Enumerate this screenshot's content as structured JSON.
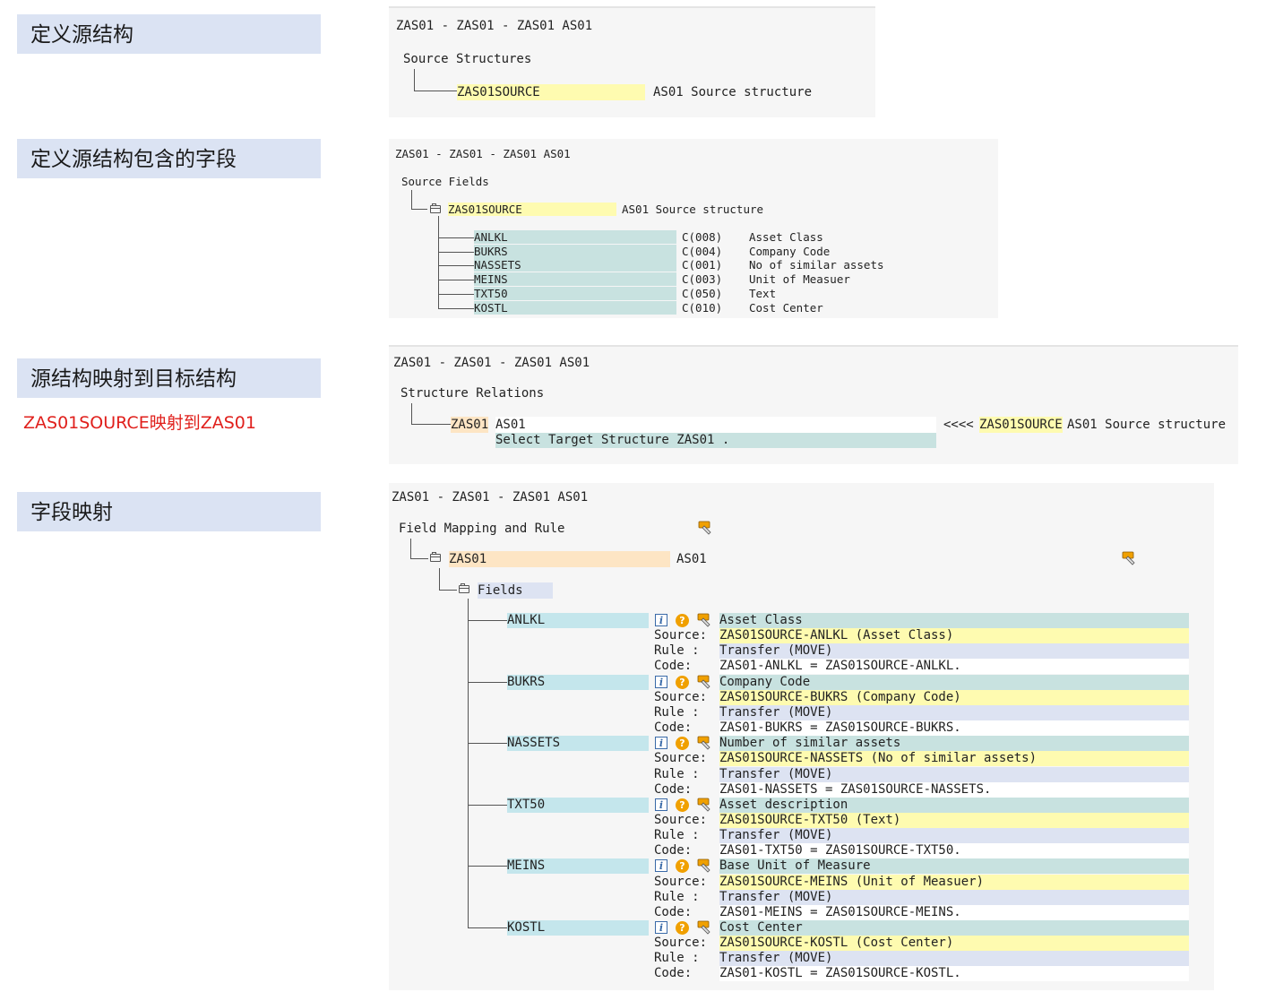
{
  "labels": {
    "define_source": "定义源结构",
    "define_fields": "定义源结构包含的字段",
    "map_structure": "源结构映射到目标结构",
    "map_note": "ZAS01SOURCE映射到ZAS01",
    "field_mapping": "字段映射"
  },
  "panel1": {
    "header": "ZAS01 - ZAS01 - ZAS01 AS01",
    "section": "Source Structures",
    "structure_name": "ZAS01SOURCE",
    "structure_desc": "AS01 Source structure"
  },
  "panel2": {
    "header": "ZAS01 - ZAS01 - ZAS01 AS01",
    "section": "Source Fields",
    "structure_name": "ZAS01SOURCE",
    "structure_desc": "AS01 Source structure",
    "fields": [
      {
        "name": "ANLKL",
        "type": "C(008)",
        "desc": "Asset Class"
      },
      {
        "name": "BUKRS",
        "type": "C(004)",
        "desc": "Company Code"
      },
      {
        "name": "NASSETS",
        "type": "C(001)",
        "desc": "No of similar assets"
      },
      {
        "name": "MEINS",
        "type": "C(003)",
        "desc": "Unit of Measuer"
      },
      {
        "name": "TXT50",
        "type": "C(050)",
        "desc": "Text"
      },
      {
        "name": "KOSTL",
        "type": "C(010)",
        "desc": "Cost Center"
      }
    ]
  },
  "panel3": {
    "header": "ZAS01 - ZAS01 - ZAS01 AS01",
    "section": "Structure Relations",
    "target_name": "ZAS01",
    "target_desc": "AS01",
    "select_text": "Select Target Structure ZAS01 .",
    "arrows": "<<<<",
    "source_name": "ZAS01SOURCE",
    "source_desc": "AS01 Source structure"
  },
  "panel4": {
    "header": "ZAS01 - ZAS01 - ZAS01 AS01",
    "section": "Field Mapping and Rule",
    "structure_name": "ZAS01",
    "structure_desc": "AS01",
    "fields_label": "Fields",
    "source_label": "Source:",
    "rule_label": "Rule :",
    "code_label": "Code:",
    "info_glyph": "i",
    "help_glyph": "?",
    "mappings": [
      {
        "name": "ANLKL",
        "desc": "Asset Class",
        "source": "ZAS01SOURCE-ANLKL (Asset Class)",
        "rule": "Transfer (MOVE)",
        "code": "ZAS01-ANLKL = ZAS01SOURCE-ANLKL."
      },
      {
        "name": "BUKRS",
        "desc": "Company Code",
        "source": "ZAS01SOURCE-BUKRS (Company Code)",
        "rule": "Transfer (MOVE)",
        "code": "ZAS01-BUKRS = ZAS01SOURCE-BUKRS."
      },
      {
        "name": "NASSETS",
        "desc": "Number of similar assets",
        "source": "ZAS01SOURCE-NASSETS (No of similar assets)",
        "rule": "Transfer (MOVE)",
        "code": "ZAS01-NASSETS = ZAS01SOURCE-NASSETS."
      },
      {
        "name": "TXT50",
        "desc": "Asset description",
        "source": "ZAS01SOURCE-TXT50 (Text)",
        "rule": "Transfer (MOVE)",
        "code": "ZAS01-TXT50 = ZAS01SOURCE-TXT50."
      },
      {
        "name": "MEINS",
        "desc": "Base Unit of Measure",
        "source": "ZAS01SOURCE-MEINS (Unit of Measuer)",
        "rule": "Transfer (MOVE)",
        "code": "ZAS01-MEINS = ZAS01SOURCE-MEINS."
      },
      {
        "name": "KOSTL",
        "desc": "Cost Center",
        "source": "ZAS01SOURCE-KOSTL (Cost Center)",
        "rule": "Transfer (MOVE)",
        "code": "ZAS01-KOSTL = ZAS01SOURCE-KOSTL."
      }
    ]
  },
  "colors": {
    "label_bg": "#dbe3f3",
    "note_red": "#e0201c",
    "yellow_hl": "#fefbb0",
    "teal_hl": "#c8e2e0",
    "orange_hl": "#fde5c4"
  },
  "icons": [
    "folder-icon",
    "info-icon",
    "help-icon",
    "note-icon"
  ]
}
